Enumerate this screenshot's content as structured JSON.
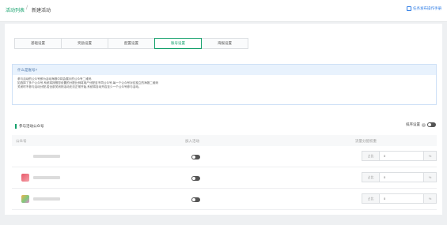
{
  "breadcrumb": {
    "parent": "活动列表",
    "separator": "/",
    "current": "新建活动"
  },
  "header": {
    "help_label": "任务发布操作手册"
  },
  "tabs": [
    "基础设置",
    "奖励设置",
    "配置设置",
    "账号设置",
    "海报设置"
  ],
  "active_tab": "账号设置",
  "notice": {
    "title": "什么是账号?",
    "lines": [
      "参与活动的公众号即为活动海报中将会展示的公众号二维码",
      "如选择了多个公众号,系统将按照您设置的分配比例将用户分配至不同公众号,每一个公众号对应独立的海报二维码",
      "关闭时不参与活动分配,若全部关闭则活动无法正常开始,系统将自动开启至少一个公众号参与活动。"
    ]
  },
  "section": {
    "title": "参与活动公众号",
    "sort_label": "排序设置",
    "help_glyph": "?"
  },
  "table": {
    "columns": [
      "公众号",
      "加入活动",
      "流量分配权重"
    ],
    "rows": [
      {
        "avatar_color": "#ffffff",
        "joined": false,
        "weight_label": "占比",
        "weight_value": "0",
        "unit": "%"
      },
      {
        "avatar_color": "#e85a6a",
        "joined": false,
        "weight_label": "占比",
        "weight_value": "0",
        "unit": "%"
      },
      {
        "avatar_color": "#7fc97f",
        "joined": false,
        "weight_label": "占比",
        "weight_value": "0",
        "unit": "%"
      }
    ]
  },
  "colors": {
    "accent": "#13a06b",
    "link": "#2c7be5"
  }
}
